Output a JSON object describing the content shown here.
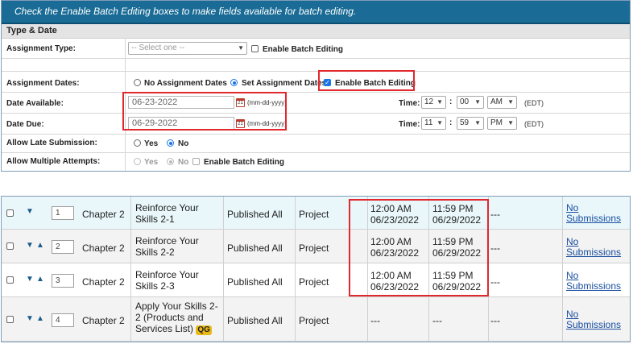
{
  "banner": {
    "text": "Check the Enable Batch Editing boxes to make fields available for batch editing."
  },
  "section": {
    "title": "Type & Date"
  },
  "assignment_type": {
    "label": "Assignment Type:",
    "placeholder": "-- Select one --",
    "batch_label": "Enable Batch Editing"
  },
  "assignment_dates": {
    "label": "Assignment Dates:",
    "option_no": "No Assignment Dates",
    "option_set": "Set Assignment Dates",
    "batch_label": "Enable Batch Editing"
  },
  "date_available": {
    "label": "Date Available:",
    "value": "06-23-2022",
    "format": "(mm-dd-yyyy)",
    "time_label": "Time:",
    "hour": "12",
    "minute": "00",
    "ampm": "AM",
    "tz": "(EDT)"
  },
  "date_due": {
    "label": "Date Due:",
    "value": "06-29-2022",
    "format": "(mm-dd-yyyy)",
    "time_label": "Time:",
    "hour": "11",
    "minute": "59",
    "ampm": "PM",
    "tz": "(EDT)"
  },
  "late_submission": {
    "label": "Allow Late Submission:",
    "yes": "Yes",
    "no": "No"
  },
  "multiple_attempts": {
    "label": "Allow Multiple Attempts:",
    "yes": "Yes",
    "no": "No",
    "batch_label": "Enable Batch Editing"
  },
  "rows": [
    {
      "order": "1",
      "chapter": "Chapter 2",
      "title": "Reinforce Your Skills 2-1",
      "status": "Published All",
      "type": "Project",
      "start_time": "12:00 AM",
      "start_date": "06/23/2022",
      "due_time": "11:59 PM",
      "due_date": "06/29/2022",
      "extra": "---",
      "submissions": "No Submissions"
    },
    {
      "order": "2",
      "chapter": "Chapter 2",
      "title": "Reinforce Your Skills 2-2",
      "status": "Published All",
      "type": "Project",
      "start_time": "12:00 AM",
      "start_date": "06/23/2022",
      "due_time": "11:59 PM",
      "due_date": "06/29/2022",
      "extra": "---",
      "submissions": "No Submissions"
    },
    {
      "order": "3",
      "chapter": "Chapter 2",
      "title": "Reinforce Your Skills 2-3",
      "status": "Published All",
      "type": "Project",
      "start_time": "12:00 AM",
      "start_date": "06/23/2022",
      "due_time": "11:59 PM",
      "due_date": "06/29/2022",
      "extra": "---",
      "submissions": "No Submissions"
    },
    {
      "order": "4",
      "chapter": "Chapter 2",
      "title": "Apply Your Skills 2-2 (Products and Services List)",
      "badge": "QG",
      "status": "Published All",
      "type": "Project",
      "start_time": "---",
      "due_time": "---",
      "extra": "---",
      "submissions": "No Submissions"
    }
  ]
}
